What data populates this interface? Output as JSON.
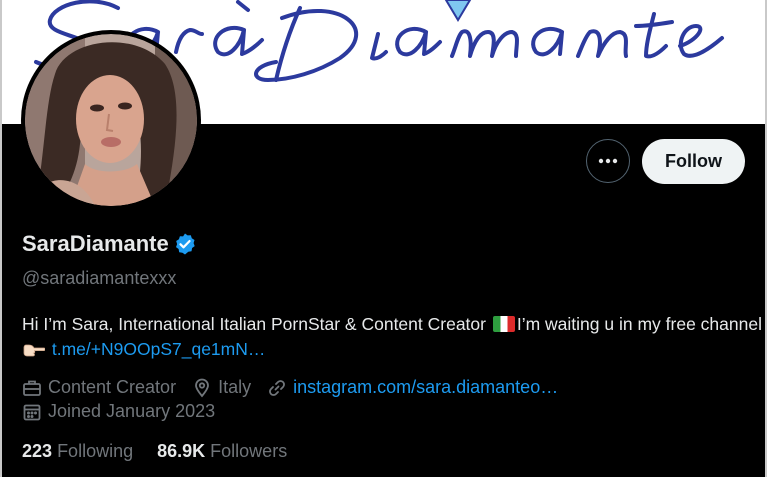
{
  "banner": {
    "script_text": "Sara Diamante"
  },
  "profile": {
    "display_name": "SaraDiamante",
    "handle": "@saradiamantexxx",
    "verified": true
  },
  "actions": {
    "follow_label": "Follow",
    "more_icon": "more-horizontal-icon"
  },
  "bio": {
    "text_part1": "Hi I’m Sara, International Italian PornStar & Content Creator",
    "flag_icon": "italy-flag-icon",
    "text_part2": "I’m waiting u in my free channel",
    "hand_icon": "pointing-hand-icon",
    "link": "t.me/+N9OOpS7_qe1mN…"
  },
  "meta": {
    "category": "Content Creator",
    "location": "Italy",
    "website": "instagram.com/sara.diamanteo…",
    "joined": "Joined January 2023"
  },
  "stats": {
    "following_count": "223",
    "following_label": "Following",
    "followers_count": "86.9K",
    "followers_label": "Followers"
  },
  "colors": {
    "background": "#000000",
    "text_primary": "#e7e9ea",
    "text_secondary": "#71767b",
    "link": "#1d9bf0",
    "banner_script": "#2c3a9e",
    "verified": "#1d9bf0"
  }
}
